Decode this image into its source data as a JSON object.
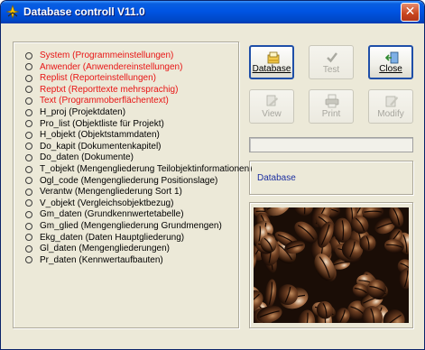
{
  "window": {
    "title": "Database controll V11.0",
    "close_glyph": "✕"
  },
  "list": {
    "items": [
      {
        "label": "System (Programmeinstellungen)",
        "color": "#e81414"
      },
      {
        "label": "Anwender (Anwendereinstellungen)",
        "color": "#e81414"
      },
      {
        "label": "Replist (Reporteinstellungen)",
        "color": "#e81414"
      },
      {
        "label": "Reptxt (Reporttexte mehrsprachig)",
        "color": "#e81414"
      },
      {
        "label": "Text (Programmoberflächentext)",
        "color": "#e81414"
      },
      {
        "label": "H_proj (Projektdaten)",
        "color": "#000000"
      },
      {
        "label": "Pro_list (Objektliste für Projekt)",
        "color": "#000000"
      },
      {
        "label": "H_objekt (Objektstammdaten)",
        "color": "#000000"
      },
      {
        "label": "Do_kapit (Dokumentenkapitel)",
        "color": "#000000"
      },
      {
        "label": "Do_daten (Dokumente)",
        "color": "#000000"
      },
      {
        "label": "T_objekt (Mengengliederung Teilobjektinformationen)",
        "color": "#000000"
      },
      {
        "label": "Ogl_code (Mengengliederung Positionslage)",
        "color": "#000000"
      },
      {
        "label": "Verantw (Mengengliederung Sort 1)",
        "color": "#000000"
      },
      {
        "label": "V_objekt (Vergleichsobjektbezug)",
        "color": "#000000"
      },
      {
        "label": "Gm_daten (Grundkennwertetabelle)",
        "color": "#000000"
      },
      {
        "label": "Gm_glied (Mengengliederung Grundmengen)",
        "color": "#000000"
      },
      {
        "label": "Ekg_daten (Daten Hauptgliederung)",
        "color": "#000000"
      },
      {
        "label": "Gl_daten (Mengengliederungen)",
        "color": "#000000"
      },
      {
        "label": "Pr_daten (Kennwertaufbauten)",
        "color": "#000000"
      }
    ]
  },
  "buttons": {
    "database": {
      "label": "Database",
      "icon": "database-icon",
      "enabled": true
    },
    "test": {
      "label": "Test",
      "icon": "checkmark-icon",
      "enabled": false
    },
    "close": {
      "label": "Close",
      "icon": "door-exit-icon",
      "enabled": true
    },
    "view": {
      "label": "View",
      "icon": "view-icon",
      "enabled": false
    },
    "print": {
      "label": "Print",
      "icon": "printer-icon",
      "enabled": false
    },
    "modify": {
      "label": "Modify",
      "icon": "modify-icon",
      "enabled": false
    }
  },
  "status": {
    "value": ""
  },
  "database_panel": {
    "label": "Database"
  },
  "photo": {
    "subject": "coffee-beans-image"
  }
}
